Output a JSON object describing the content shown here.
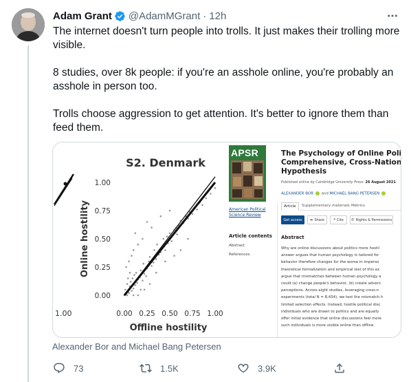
{
  "tweet": {
    "author_name": "Adam Grant",
    "handle": "@AdamMGrant",
    "separator": "·",
    "time": "12h",
    "paragraphs": [
      "The internet doesn't turn people into trolls. It just makes their trolling more visible.",
      "8 studies, over 8k people: if you're an asshole online, you're probably an asshole in person too.",
      "Trolls choose aggression to get attention. It's better to ignore them than feed them."
    ],
    "media_caption": "Alexander Bor and Michael Bang Petersen",
    "actions": {
      "replies": "73",
      "retweets": "1.5K",
      "likes": "3.9K"
    },
    "colors": {
      "verified": "#1d9bf0",
      "secondary": "#536471"
    }
  },
  "article": {
    "journal_logo": "APSR",
    "journal_link": "American Political Science Review",
    "contents_title": "Article contents",
    "contents_items": [
      "Abstract",
      "References"
    ],
    "title_lines": [
      "The Psychology of Online Politica",
      "Comprehensive, Cross-National T",
      "Hypothesis"
    ],
    "published_prefix": "Published online by Cambridge University Press:",
    "published_date": "26 August 2021",
    "author1": "ALEXANDER BOR",
    "author_and": "and",
    "author2": "MICHAEL BANG PETERSEN",
    "tabs": [
      "Article",
      "Supplementary materials",
      "Metrics"
    ],
    "buttons": [
      "Get access",
      "Share",
      "Cite",
      "Rights & Permissions"
    ],
    "abstract_heading": "Abstract",
    "abstract_lines": [
      "Why are online discussions about politics more hostil",
      "answer argues that human psychology is tailored for",
      "behavior therefore changes for the worse in imperso",
      "theoretical formalization and empirical test of this ex",
      "argue that mismatches between human psychology a",
      "could (a) change people's behavior, (b) create advers",
      "perceptions. Across eight studies, leveraging cross-n",
      "experiments (total N = 8,434), we test the mismatch h",
      "limited selection effects. Instead, hostile political disc",
      "individuals who are drawn to politics and are equally",
      "offer initial evidence that online discussions feel more",
      "such individuals is more visible online than offline."
    ]
  },
  "chart_data": {
    "type": "scatter",
    "title": "S2. Denmark",
    "xlabel": "Offline hostility",
    "ylabel": "Online hostility",
    "xlim": [
      0,
      1
    ],
    "ylim": [
      0,
      1
    ],
    "x_ticks": [
      "0.00",
      "0.25",
      "0.50",
      "0.75",
      "1.00"
    ],
    "y_ticks": [
      "0.00",
      "0.25",
      "0.50",
      "0.75",
      "1.00"
    ],
    "left_panel_tick": "1.00",
    "series": [
      {
        "kind": "points",
        "x": [
          0.0,
          0.02,
          0.04,
          0.01,
          0.05,
          0.06,
          0.03,
          0.08,
          0.1,
          0.07,
          0.12,
          0.09,
          0.14,
          0.11,
          0.15,
          0.13,
          0.17,
          0.2,
          0.18,
          0.22,
          0.25,
          0.21,
          0.24,
          0.27,
          0.3,
          0.28,
          0.32,
          0.35,
          0.33,
          0.38,
          0.4,
          0.36,
          0.42,
          0.45,
          0.43,
          0.48,
          0.5,
          0.47,
          0.52,
          0.55,
          0.58,
          0.6,
          0.57,
          0.62,
          0.65,
          0.68,
          0.7,
          0.72,
          0.75,
          0.78,
          0.8,
          0.83,
          0.86,
          0.9,
          0.95,
          1.0,
          0.02,
          0.05,
          0.1,
          0.15,
          0.2,
          0.08,
          0.12,
          0.3,
          0.25,
          0.4,
          0.18,
          0.06,
          0.04,
          0.35,
          0.55,
          0.62,
          0.45,
          0.7,
          0.5,
          0.15,
          0.22,
          0.28,
          0.1,
          0.03
        ],
        "y": [
          0.0,
          0.01,
          0.03,
          0.05,
          0.02,
          0.08,
          0.1,
          0.04,
          0.06,
          0.12,
          0.09,
          0.15,
          0.11,
          0.18,
          0.14,
          0.2,
          0.16,
          0.13,
          0.22,
          0.19,
          0.24,
          0.28,
          0.17,
          0.3,
          0.26,
          0.34,
          0.29,
          0.32,
          0.4,
          0.36,
          0.38,
          0.45,
          0.42,
          0.4,
          0.5,
          0.46,
          0.55,
          0.52,
          0.48,
          0.58,
          0.54,
          0.62,
          0.6,
          0.66,
          0.64,
          0.7,
          0.68,
          0.74,
          0.72,
          0.78,
          0.76,
          0.82,
          0.8,
          0.86,
          0.9,
          0.95,
          0.25,
          0.3,
          0.4,
          0.45,
          0.5,
          0.35,
          0.55,
          0.6,
          0.65,
          0.7,
          0.05,
          0.2,
          0.15,
          0.2,
          0.35,
          0.4,
          0.3,
          0.5,
          0.75,
          0.0,
          0.05,
          0.1,
          0.0,
          0.0
        ]
      },
      {
        "kind": "fit-line",
        "x": [
          0.0,
          1.0
        ],
        "y": [
          0.0,
          1.0
        ]
      },
      {
        "kind": "identity-line",
        "x": [
          0.0,
          1.0
        ],
        "y": [
          0.0,
          1.05
        ]
      }
    ]
  }
}
